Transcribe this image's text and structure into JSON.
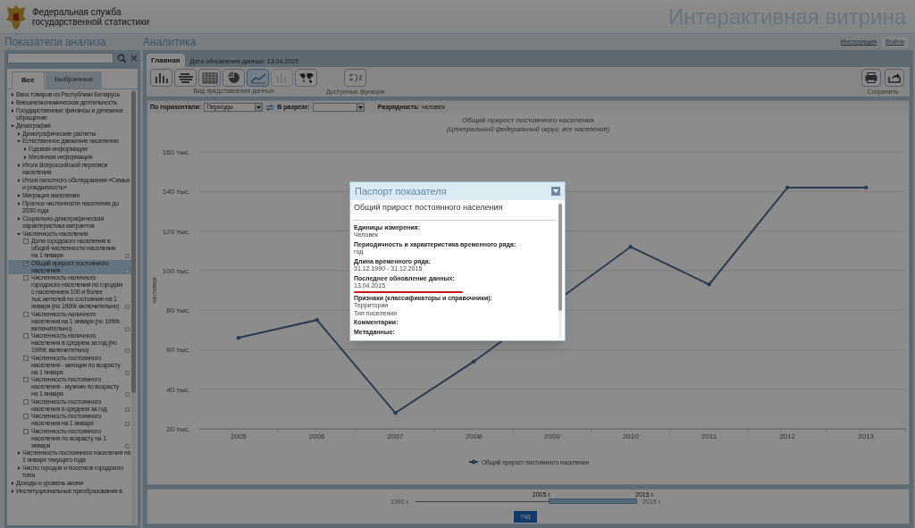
{
  "header": {
    "org_name": [
      "Федеральная служба",
      "государственной статистики"
    ],
    "title": "Интерактивная витрина"
  },
  "left_panel": {
    "heading": "Показатели анализа",
    "tabs": [
      {
        "label": "Все",
        "selected": true
      },
      {
        "label": "Выбранные",
        "selected": false
      }
    ],
    "tree": [
      {
        "kind": "folder",
        "label": "Ввоз товаров из Республики Беларусь",
        "expanded": false
      },
      {
        "kind": "folder",
        "label": "Внешнеэкономическая деятельность",
        "expanded": false
      },
      {
        "kind": "folder",
        "label": "Государственные финансы и денежное обращение",
        "expanded": false
      },
      {
        "kind": "folder",
        "label": "Демография",
        "expanded": true,
        "children": [
          {
            "kind": "folder",
            "label": "Демографические расчеты",
            "expanded": false
          },
          {
            "kind": "folder",
            "label": "Естественное движение населения",
            "expanded": true,
            "children": [
              {
                "kind": "folder",
                "label": "Годовая информация",
                "expanded": false
              },
              {
                "kind": "folder",
                "label": "Месячная информация",
                "expanded": false
              }
            ]
          },
          {
            "kind": "folder",
            "label": "Итоги Всероссийской переписи населения",
            "expanded": false
          },
          {
            "kind": "folder",
            "label": "Итоги пилотного обследования «Семья и рождаемость»",
            "expanded": false
          },
          {
            "kind": "folder",
            "label": "Миграция населения",
            "expanded": false
          },
          {
            "kind": "folder",
            "label": "Прогноз численности населения до 2030 года",
            "expanded": false
          },
          {
            "kind": "folder",
            "label": "Социально-демографическая характеристика мигрантов",
            "expanded": false
          },
          {
            "kind": "folder",
            "label": "Численность населения",
            "expanded": true,
            "children": [
              {
                "kind": "indicator",
                "label": "Доля городского населения в общей численности населения на 1 января",
                "checked": false,
                "selected": false
              },
              {
                "kind": "indicator",
                "label": "Общий прирост постоянного населения",
                "checked": true,
                "selected": true
              },
              {
                "kind": "indicator",
                "label": "Численность наличного городского населения по городам с населением 100 и более тыс.жителей по состоянию на 1 января (по 1999г. включительно)",
                "checked": false,
                "selected": false
              },
              {
                "kind": "indicator",
                "label": "Численность наличного населения на 1 января (по 1999г. включительно)",
                "checked": false,
                "selected": false
              },
              {
                "kind": "indicator",
                "label": "Численность наличного населения в среднем за год (по 1999г. включительно)",
                "checked": false,
                "selected": false
              },
              {
                "kind": "indicator",
                "label": "Численность постоянного населения - женщин по возрасту на 1 января",
                "checked": false,
                "selected": false
              },
              {
                "kind": "indicator",
                "label": "Численность постоянного населения - мужчин по возрасту на 1 января",
                "checked": false,
                "selected": false
              },
              {
                "kind": "indicator",
                "label": "Численность постоянного населения в среднем за год",
                "checked": false,
                "selected": false
              },
              {
                "kind": "indicator",
                "label": "Численность постоянного населения на 1 января",
                "checked": false,
                "selected": false
              },
              {
                "kind": "indicator",
                "label": "Численность постоянного населения по возрасту на 1 января",
                "checked": false,
                "selected": false
              }
            ]
          },
          {
            "kind": "folder",
            "label": "Численность постоянного населения на 1 января текущего года",
            "expanded": false
          },
          {
            "kind": "folder",
            "label": "Число городов и поселков городского типа",
            "expanded": false
          }
        ]
      },
      {
        "kind": "folder",
        "label": "Доходы и уровень жизни",
        "expanded": false
      },
      {
        "kind": "folder",
        "label": "Институциональные преобразования в",
        "expanded": false
      }
    ]
  },
  "main": {
    "heading": "Аналитика",
    "links": [
      "Инструкция",
      "Войти"
    ],
    "tab": {
      "label": "Главная",
      "selected": true
    },
    "update_note": "Дата обновления данных: 13.04.2015",
    "views": [
      {
        "selected": false,
        "disabled": false
      },
      {
        "selected": false,
        "disabled": false
      },
      {
        "selected": false,
        "disabled": false
      },
      {
        "selected": false,
        "disabled": false
      },
      {
        "selected": true,
        "disabled": false
      },
      {
        "selected": false,
        "disabled": true
      },
      {
        "selected": false,
        "disabled": false
      }
    ],
    "views_label": "Вид представления данных",
    "functions_label": "Доступные функции",
    "save_label": "Сохранить",
    "filters": {
      "horizontal_label": "По горизонтали:",
      "horizontal_value": "Периоды",
      "slice_label": "В разрезе:",
      "unit_label": "Разрядность:",
      "unit_value": "человек"
    },
    "subtitle": "(Центральный федеральный округ, все население)",
    "chart_data": {
      "type": "line",
      "title": "Общий прирост постоянного населения",
      "ylabel": "человек",
      "categories": [
        "2005",
        "2006",
        "2007",
        "2008",
        "2009",
        "2010",
        "2011",
        "2012",
        "2013"
      ],
      "series": [
        {
          "name": "Общий прирост постоянного населения",
          "color": "#4a6c93",
          "values": [
            66,
            75,
            28,
            54,
            null,
            112,
            93,
            142,
            142
          ]
        }
      ],
      "grid": true,
      "ylim": [
        20,
        160
      ],
      "yticks": [
        {
          "value": 20,
          "label": "20 тыс."
        },
        {
          "value": 40,
          "label": "40 тыс."
        },
        {
          "value": 60,
          "label": "60 тыс."
        },
        {
          "value": 80,
          "label": "80 тыс."
        },
        {
          "value": 100,
          "label": "100 тыс."
        },
        {
          "value": 120,
          "label": "120 тыс."
        },
        {
          "value": 140,
          "label": "140 тыс."
        },
        {
          "value": 160,
          "label": "160 тыс."
        }
      ]
    },
    "range": {
      "min_label": "1990 г.",
      "from_label": "2005 г.",
      "to_label": "2015 г.",
      "max_label": "2015 г.",
      "period_button": "год"
    }
  },
  "dialog": {
    "title": "Паспорт показателя",
    "heading": "Общий прирост постоянного населения",
    "fields": [
      {
        "label": "Единицы измерения:",
        "values": [
          "Человек"
        ]
      },
      {
        "label": "Периодичность и характеристика временного ряда:",
        "values": [
          "год"
        ]
      },
      {
        "label": "Длина временного ряда:",
        "values": [
          "31.12.1990 - 31.12.2015"
        ]
      },
      {
        "label": "Последнее обновление данных:",
        "values": [
          "13.04.2015"
        ],
        "underlined": true
      },
      {
        "label": "Признаки (классификаторы и справочники):",
        "values": [
          "Территории",
          "Тип поселения"
        ]
      },
      {
        "label": "Комментарии:"
      },
      {
        "label": "Метаданные:"
      }
    ]
  }
}
